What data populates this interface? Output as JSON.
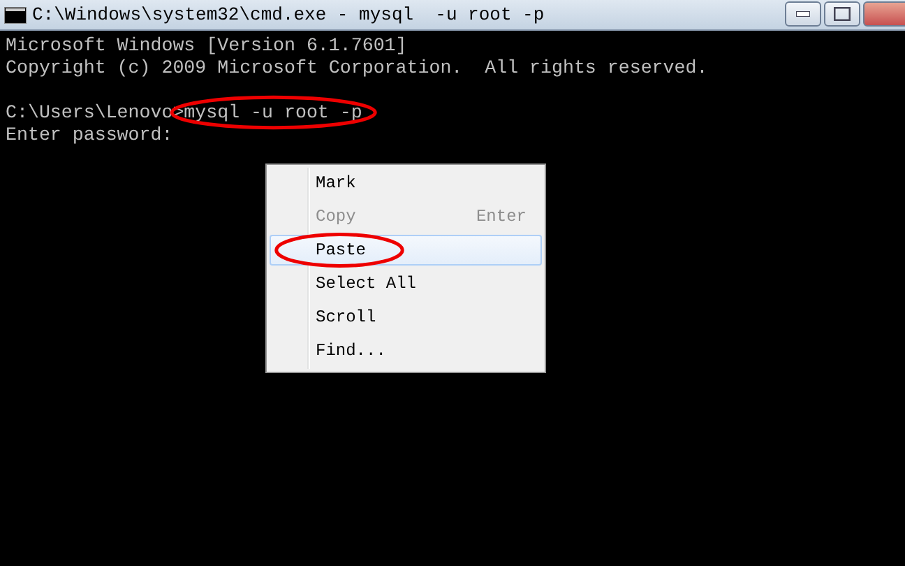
{
  "window": {
    "title": "C:\\Windows\\system32\\cmd.exe - mysql  -u root -p"
  },
  "console": {
    "blocks": [
      {
        "lines": [
          {
            "prompt": "Microsoft Windows [Version 6.1.7601]"
          },
          {
            "prompt": "Copyright (c) 2009 Microsoft Corporation.  All rights reserved."
          }
        ]
      },
      {
        "lines": [
          {
            "prompt": "C:\\Users\\Lenovo",
            "command": ">mysql -u root -p",
            "circled": true
          },
          {
            "prompt": "Enter password:"
          }
        ]
      }
    ]
  },
  "context_menu": {
    "items": [
      {
        "label": "Mark",
        "disabled": false,
        "selected": false,
        "circled": false
      },
      {
        "label": "Copy",
        "shortcut": "Enter",
        "disabled": true,
        "selected": false,
        "circled": false
      },
      {
        "label": "Paste",
        "disabled": false,
        "selected": true,
        "circled": true
      },
      {
        "label": "Select All",
        "disabled": false,
        "selected": false,
        "circled": false
      },
      {
        "label": "Scroll",
        "disabled": false,
        "selected": false,
        "circled": false
      },
      {
        "label": "Find...",
        "disabled": false,
        "selected": false,
        "circled": false
      }
    ]
  }
}
